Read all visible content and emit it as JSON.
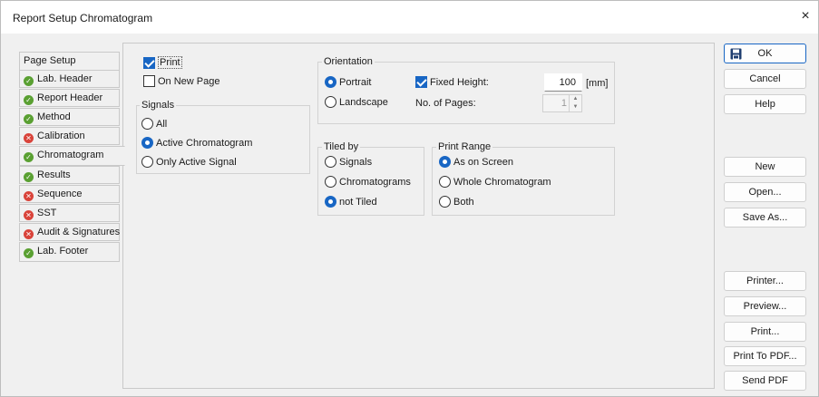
{
  "window": {
    "title": "Report Setup Chromatogram",
    "close_glyph": "×"
  },
  "tabs": [
    {
      "label": "Page Setup",
      "status": "none"
    },
    {
      "label": "Lab. Header",
      "status": "ok"
    },
    {
      "label": "Report Header",
      "status": "ok"
    },
    {
      "label": "Method",
      "status": "ok"
    },
    {
      "label": "Calibration",
      "status": "error"
    },
    {
      "label": "Chromatogram",
      "status": "ok",
      "active": true
    },
    {
      "label": "Results",
      "status": "ok"
    },
    {
      "label": "Sequence",
      "status": "error"
    },
    {
      "label": "SST",
      "status": "error"
    },
    {
      "label": "Audit & Signatures",
      "status": "error"
    },
    {
      "label": "Lab. Footer",
      "status": "ok"
    }
  ],
  "print": {
    "label": "Print",
    "checked": true
  },
  "on_new_page": {
    "label": "On New Page",
    "checked": false
  },
  "signals": {
    "title": "Signals",
    "options": [
      "All",
      "Active Chromatogram",
      "Only Active Signal"
    ],
    "selected": "Active Chromatogram"
  },
  "orientation": {
    "title": "Orientation",
    "options": [
      "Portrait",
      "Landscape"
    ],
    "selected": "Portrait",
    "fixed_height_label": "Fixed Height:",
    "fixed_height_checked": true,
    "fixed_height_value": "100",
    "fixed_height_unit": "[mm]",
    "pages_label": "No. of Pages:",
    "pages_value": "1"
  },
  "tiled_by": {
    "title": "Tiled by",
    "options": [
      "Signals",
      "Chromatograms",
      "not Tiled"
    ],
    "selected": "not Tiled"
  },
  "print_range": {
    "title": "Print Range",
    "options": [
      "As on Screen",
      "Whole Chromatogram",
      "Both"
    ],
    "selected": "As on Screen"
  },
  "buttons": {
    "ok": "OK",
    "cancel": "Cancel",
    "help": "Help",
    "new": "New",
    "open": "Open...",
    "save_as": "Save As...",
    "printer": "Printer...",
    "preview": "Preview...",
    "print": "Print...",
    "print_to_pdf": "Print To PDF...",
    "send_pdf": "Send PDF"
  },
  "colors": {
    "accent": "#1866c4",
    "ok": "#5aa032",
    "error": "#d9433a"
  },
  "icons": {
    "ok_status": "check-circle-icon",
    "error_status": "x-circle-icon",
    "ok_button": "floppy-disk-icon"
  }
}
